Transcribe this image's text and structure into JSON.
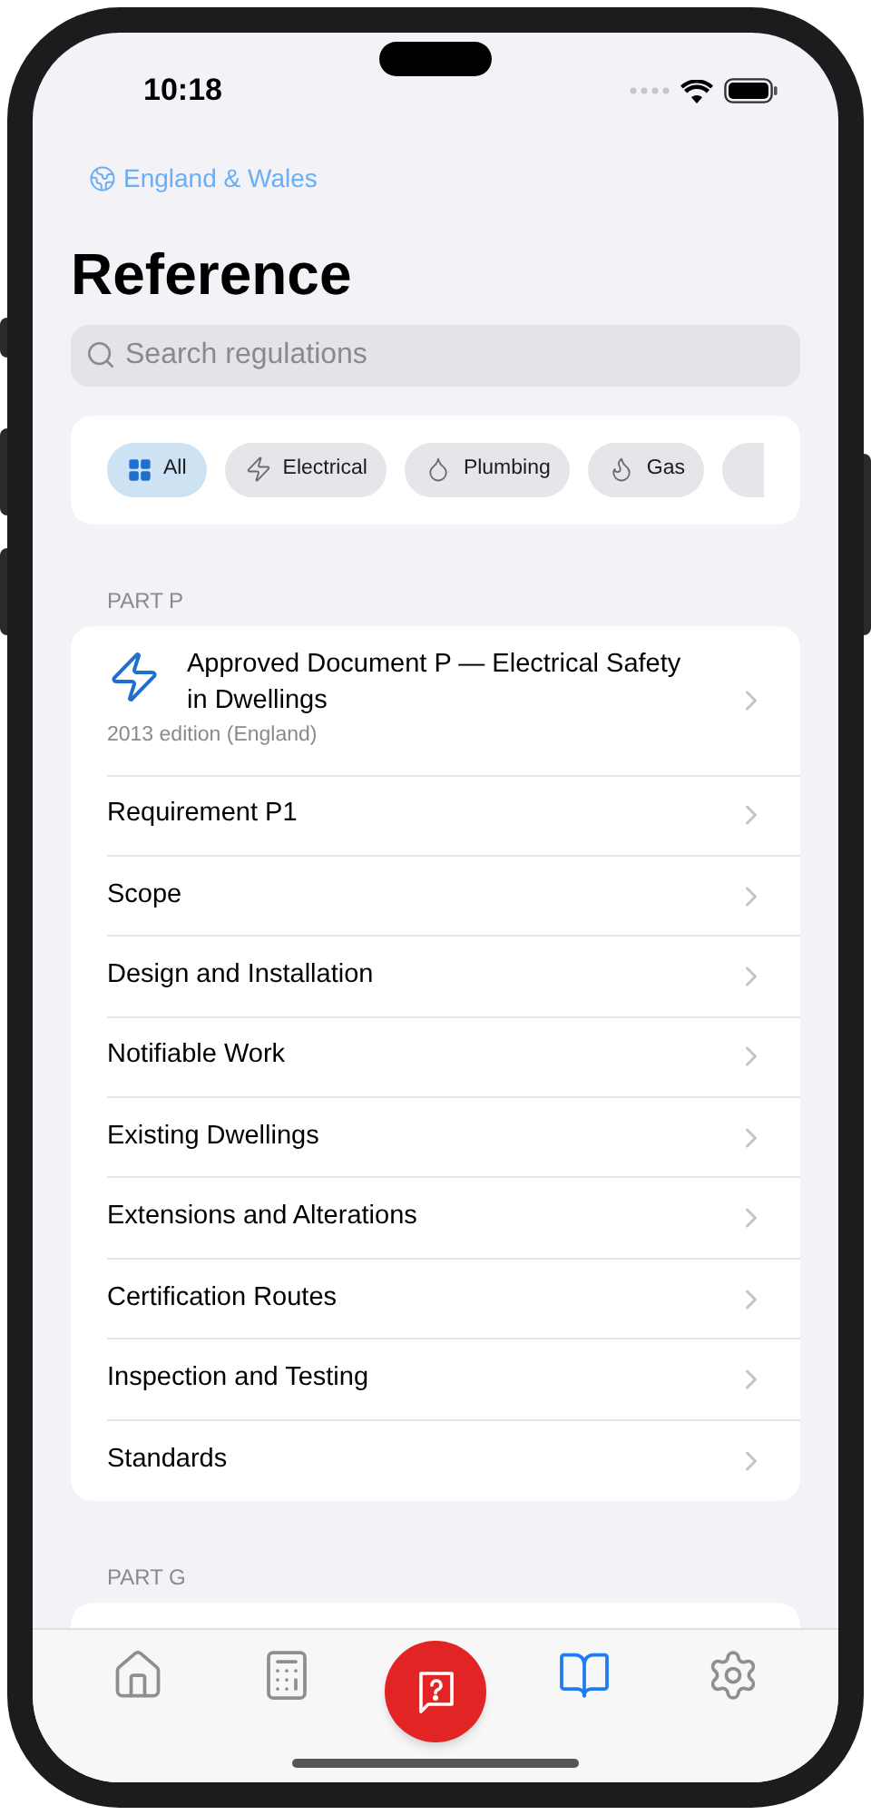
{
  "status_bar": {
    "time": "10:18"
  },
  "region": "England & Wales",
  "title": "Reference",
  "search": {
    "placeholder": "Search regulations"
  },
  "filters": [
    {
      "kind": "all",
      "label": "All",
      "selected": true
    },
    {
      "kind": "electrical",
      "label": "Electrical",
      "selected": false
    },
    {
      "kind": "plumbing",
      "label": "Plumbing",
      "selected": false
    },
    {
      "kind": "gas",
      "label": "Gas",
      "selected": false
    }
  ],
  "sections": [
    {
      "heading": "PART P",
      "document": {
        "kind": "electrical",
        "title": "Approved Document P — Electrical Safety in Dwellings",
        "subtitle": "2013 edition (England)"
      },
      "items": [
        "Requirement P1",
        "Scope",
        "Design and Installation",
        "Notifiable Work",
        "Existing Dwellings",
        "Extensions and Alterations",
        "Certification Routes",
        "Inspection and Testing",
        "Standards"
      ]
    },
    {
      "heading": "PART G"
    }
  ],
  "tab_bar": [
    {
      "kind": "home",
      "selected": false
    },
    {
      "kind": "calculator",
      "selected": false
    },
    {
      "kind": "ask",
      "selected": false
    },
    {
      "kind": "reference",
      "selected": true
    },
    {
      "kind": "settings",
      "selected": false
    }
  ]
}
